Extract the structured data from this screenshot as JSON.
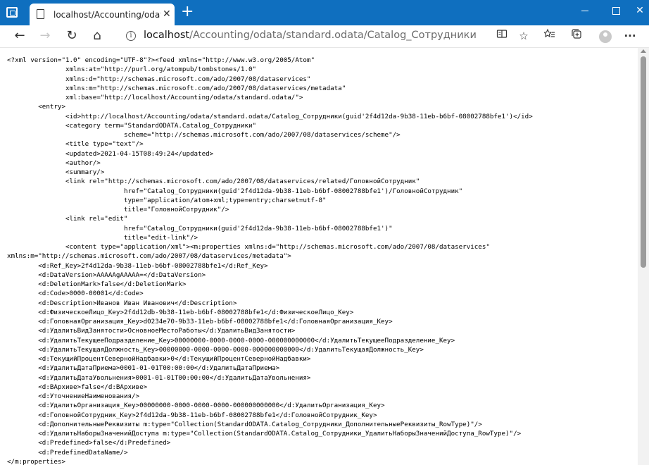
{
  "browser": {
    "tab_title": "localhost/Accounting/odata/standard.odata/Catalog_Сотрудники",
    "new_tab_symbol": "+",
    "address": {
      "scheme_host": "localhost",
      "path": "/Accounting/odata/standard.odata/Catalog_Сотрудники"
    },
    "icons": {
      "back": "←",
      "forward": "→",
      "reload": "↻",
      "home": "⌂",
      "info": "i",
      "reader": "reader-view-icon",
      "add_favorite": "☆",
      "favorites": "favorites-icon",
      "collections": "collections-icon",
      "more": "···",
      "close": "✕",
      "minimize": "minimize-icon",
      "maximize": "maximize-icon"
    }
  },
  "document": {
    "lines": [
      "<?xml version=\"1.0\" encoding=\"UTF-8\"?><feed xmlns=\"http://www.w3.org/2005/Atom\"",
      "               xmlns:at=\"http://purl.org/atompub/tombstones/1.0\"",
      "               xmlns:d=\"http://schemas.microsoft.com/ado/2007/08/dataservices\"",
      "               xmlns:m=\"http://schemas.microsoft.com/ado/2007/08/dataservices/metadata\"",
      "               xml:base=\"http://localhost/Accounting/odata/standard.odata/\">",
      "        <entry>",
      "               <id>http://localhost/Accounting/odata/standard.odata/Catalog_Сотрудники(guid'2f4d12da-9b38-11eb-b6bf-08002788bfe1')</id>",
      "               <category term=\"StandardODATA.Catalog_Сотрудники\"",
      "                              scheme=\"http://schemas.microsoft.com/ado/2007/08/dataservices/scheme\"/>",
      "               <title type=\"text\"/>",
      "               <updated>2021-04-15T08:49:24</updated>",
      "               <author/>",
      "               <summary/>",
      "               <link rel=\"http://schemas.microsoft.com/ado/2007/08/dataservices/related/ГоловнойСотрудник\"",
      "                              href=\"Catalog_Сотрудники(guid'2f4d12da-9b38-11eb-b6bf-08002788bfe1')/ГоловнойСотрудник\"",
      "                              type=\"application/atom+xml;type=entry;charset=utf-8\"",
      "                              title=\"ГоловнойСотрудник\"/>",
      "               <link rel=\"edit\"",
      "                              href=\"Catalog_Сотрудники(guid'2f4d12da-9b38-11eb-b6bf-08002788bfe1')\"",
      "                              title=\"edit-link\"/>",
      "               <content type=\"application/xml\"><m:properties xmlns:d=\"http://schemas.microsoft.com/ado/2007/08/dataservices\"",
      "xmlns:m=\"http://schemas.microsoft.com/ado/2007/08/dataservices/metadata\">",
      "        <d:Ref_Key>2f4d12da-9b38-11eb-b6bf-08002788bfe1</d:Ref_Key>",
      "        <d:DataVersion>AAAAAgAAAAA=</d:DataVersion>",
      "        <d:DeletionMark>false</d:DeletionMark>",
      "        <d:Code>0000-00001</d:Code>",
      "        <d:Description>Иванов Иван Иванович</d:Description>",
      "        <d:ФизическоеЛицо_Key>2f4d12db-9b38-11eb-b6bf-08002788bfe1</d:ФизическоеЛицо_Key>",
      "        <d:ГоловнаяОрганизация_Key>d0234e70-9b33-11eb-b6bf-08002788bfe1</d:ГоловнаяОрганизация_Key>",
      "        <d:УдалитьВидЗанятости>ОсновноеМестоРаботы</d:УдалитьВидЗанятости>",
      "        <d:УдалитьТекущееПодразделение_Key>00000000-0000-0000-0000-000000000000</d:УдалитьТекущееПодразделение_Key>",
      "        <d:УдалитьТекущаяДолжность_Key>00000000-0000-0000-0000-000000000000</d:УдалитьТекущаяДолжность_Key>",
      "        <d:ТекущийПроцентСевернойНадбавки>0</d:ТекущийПроцентСевернойНадбавки>",
      "        <d:УдалитьДатаПриема>0001-01-01T00:00:00</d:УдалитьДатаПриема>",
      "        <d:УдалитьДатаУвольнения>0001-01-01T00:00:00</d:УдалитьДатаУвольнения>",
      "        <d:ВАрхиве>false</d:ВАрхиве>",
      "        <d:УточнениеНаименования/>",
      "        <d:УдалитьОрганизация_Key>00000000-0000-0000-0000-000000000000</d:УдалитьОрганизация_Key>",
      "        <d:ГоловнойСотрудник_Key>2f4d12da-9b38-11eb-b6bf-08002788bfe1</d:ГоловнойСотрудник_Key>",
      "        <d:ДополнительныеРеквизиты m:type=\"Collection(StandardODATA.Catalog_Сотрудники_ДополнительныеРеквизиты_RowType)\"/>",
      "        <d:УдалитьНаборыЗначенийДоступа m:type=\"Collection(StandardODATA.Catalog_Сотрудники_УдалитьНаборыЗначенийДоступа_RowType)\"/>",
      "        <d:Predefined>false</d:Predefined>",
      "        <d:PredefinedDataName/>",
      "</m:properties>",
      "               </content>"
    ]
  }
}
